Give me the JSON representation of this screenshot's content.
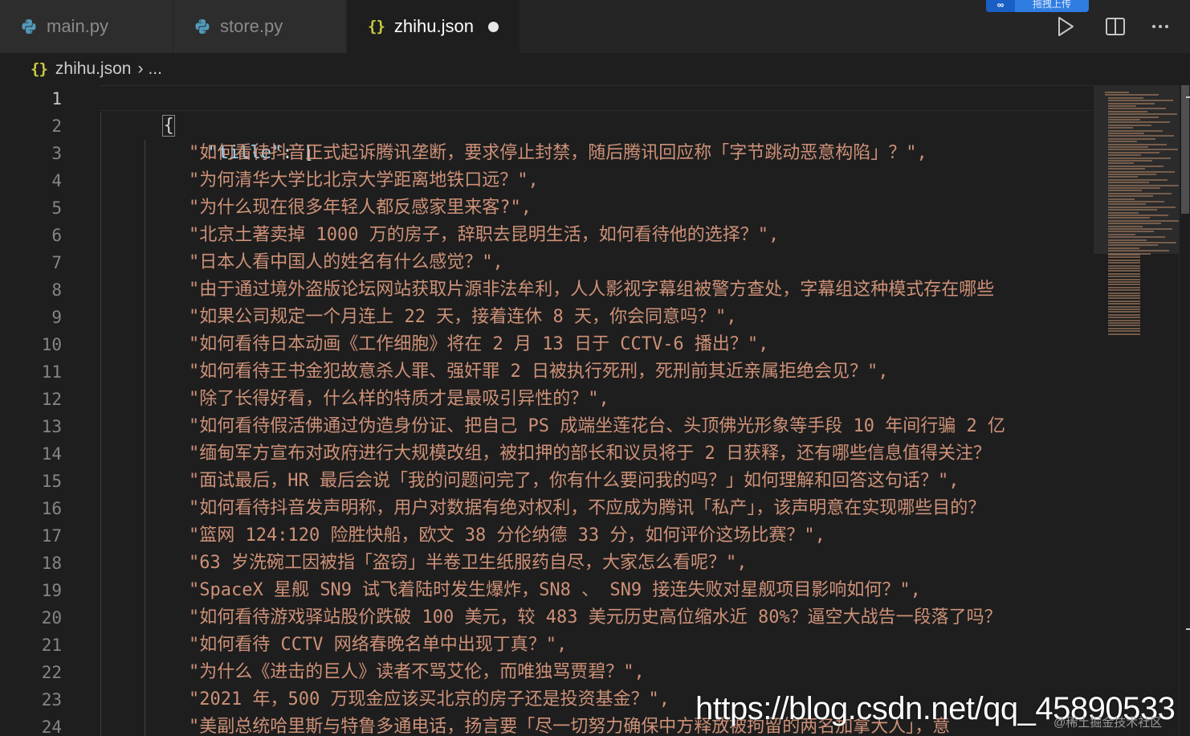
{
  "tabs": [
    {
      "label": "main.py",
      "icon": "python-icon"
    },
    {
      "label": "store.py",
      "icon": "python-icon"
    },
    {
      "label": "zhihu.json",
      "icon": "json-braces-icon",
      "dirty": true
    }
  ],
  "upload_badge": {
    "label": "拖拽上传"
  },
  "toolbar": {
    "run_icon": "play-icon",
    "split_icon": "split-editor-icon",
    "more_icon": "ellipsis-icon"
  },
  "breadcrumb": {
    "file": "zhihu.json",
    "rest": "..."
  },
  "colors": {
    "key": "#9cdcfe",
    "string": "#ce9178",
    "punctuation": "#d4d4d4",
    "line_number": "#858585"
  },
  "editor": {
    "line_numbers": [
      "1",
      "2",
      "3",
      "4",
      "5",
      "6",
      "7",
      "8",
      "9",
      "10",
      "11",
      "12",
      "13",
      "14",
      "15",
      "16",
      "17",
      "18",
      "19",
      "20",
      "21",
      "22",
      "23",
      "24"
    ],
    "open_brace": "{",
    "key_title": "\"title\"",
    "key_suffix": ": [",
    "strings": [
      "\"如何看待抖音正式起诉腾讯垄断，要求停止封禁，随后腾讯回应称「字节跳动恶意构陷」？\",",
      "\"为何清华大学比北京大学距离地铁口远？\",",
      "\"为什么现在很多年轻人都反感家里来客?\",",
      "\"北京土著卖掉 1000 万的房子，辞职去昆明生活，如何看待他的选择？\",",
      "\"日本人看中国人的姓名有什么感觉？\",",
      "\"由于通过境外盗版论坛网站获取片源非法牟利，人人影视字幕组被警方查处，字幕组这种模式存在哪些",
      "\"如果公司规定一个月连上 22 天，接着连休 8 天，你会同意吗？\",",
      "\"如何看待日本动画《工作细胞》将在 2 月 13 日于 CCTV-6 播出？\",",
      "\"如何看待王书金犯故意杀人罪、强奸罪 2 日被执行死刑，死刑前其近亲属拒绝会见？\",",
      "\"除了长得好看，什么样的特质才是最吸引异性的？\",",
      "\"如何看待假活佛通过伪造身份证、把自己 PS 成端坐莲花台、头顶佛光形象等手段 10 年间行骗 2 亿",
      "\"缅甸军方宣布对政府进行大规模改组，被扣押的部长和议员将于 2 日获释，还有哪些信息值得关注？",
      "\"面试最后，HR 最后会说「我的问题问完了，你有什么要问我的吗？」如何理解和回答这句话？\",",
      "\"如何看待抖音发声明称，用户对数据有绝对权利，不应成为腾讯「私产」，该声明意在实现哪些目的？",
      "\"篮网 124:120 险胜快船，欧文 38 分伦纳德 33 分，如何评价这场比赛？\",",
      "\"63 岁洗碗工因被指「盗窃」半卷卫生纸服药自尽，大家怎么看呢？\",",
      "\"SpaceX 星舰 SN9 试飞着陆时发生爆炸，SN8 、 SN9 接连失败对星舰项目影响如何？\",",
      "\"如何看待游戏驿站股价跌破 100 美元，较 483 美元历史高位缩水近 80%？逼空大战告一段落了吗？",
      "\"如何看待 CCTV 网络春晚名单中出现丁真？\",",
      "\"为什么《进击的巨人》读者不骂艾伦，而唯独骂贾碧？\",",
      "\"2021 年，500 万现金应该买北京的房子还是投资基金？\",",
      "\"美副总统哈里斯与特鲁多通电话，扬言要「尽一切努力确保中方释放被拘留的两名加拿大人」，意"
    ]
  },
  "watermark": {
    "text": "https://blog.csdn.net/qq_45890533",
    "sub": "@稀土掘金技术社区"
  }
}
